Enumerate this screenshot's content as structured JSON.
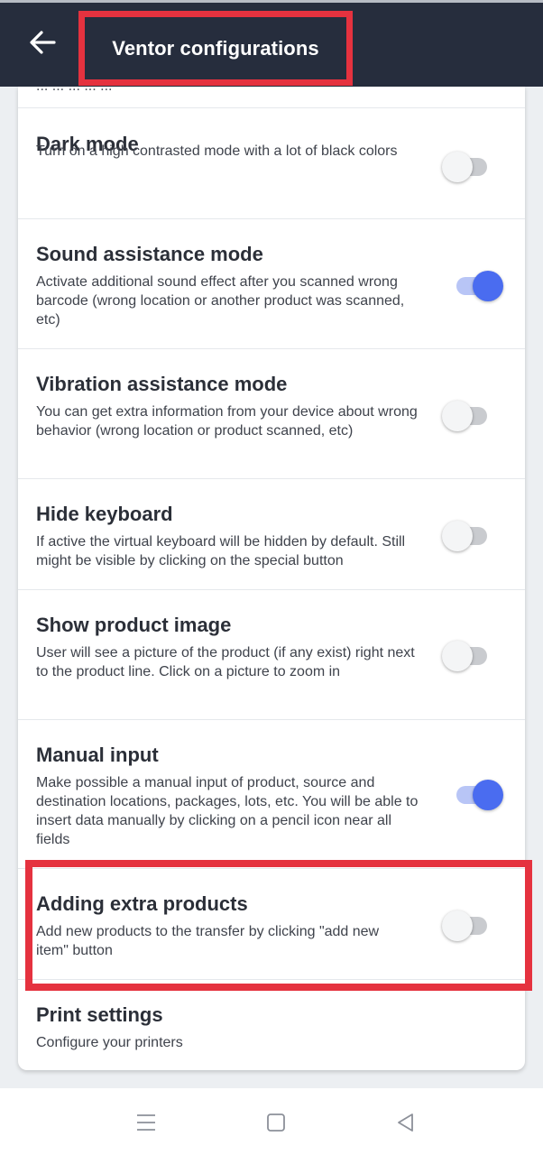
{
  "appbar": {
    "title": "Ventor configurations",
    "back_icon": "arrow-left-icon"
  },
  "partial_row_text": "...  ...  ...  ...  ...",
  "settings": [
    {
      "title": "Dark mode",
      "description": "Turn on a high contrasted mode with a lot of black colors",
      "enabled": false
    },
    {
      "title": "Sound assistance mode",
      "description": "Activate additional sound effect after you scanned wrong barcode (wrong location or another product was scanned, etc)",
      "enabled": true
    },
    {
      "title": "Vibration assistance mode",
      "description": "You can get extra information from your device about wrong behavior (wrong location or product scanned, etc)",
      "enabled": false
    },
    {
      "title": "Hide keyboard",
      "description": "If active the virtual keyboard will be hidden by default. Still might be visible by clicking on the special button",
      "enabled": false
    },
    {
      "title": "Show product image",
      "description": "User will see a picture of the product (if any exist) right next to the product line. Click on a picture to zoom in",
      "enabled": false
    },
    {
      "title": "Manual input",
      "description": "Make possible a manual input of product, source and destination locations, packages, lots, etc. You will be able to insert data manually by clicking on a pencil icon near all fields",
      "enabled": true
    },
    {
      "title": "Adding extra products",
      "description": "Add new products to the transfer by clicking \"add new item\" button",
      "enabled": false
    }
  ],
  "print_settings": {
    "title": "Print settings",
    "description": "Configure your printers"
  },
  "navbar": {
    "menu_icon": "menu-icon",
    "home_icon": "square-home-icon",
    "back_icon": "triangle-back-icon"
  },
  "colors": {
    "appbar_bg": "#262d3d",
    "accent": "#4a6cf0",
    "highlight": "#e5323f"
  }
}
